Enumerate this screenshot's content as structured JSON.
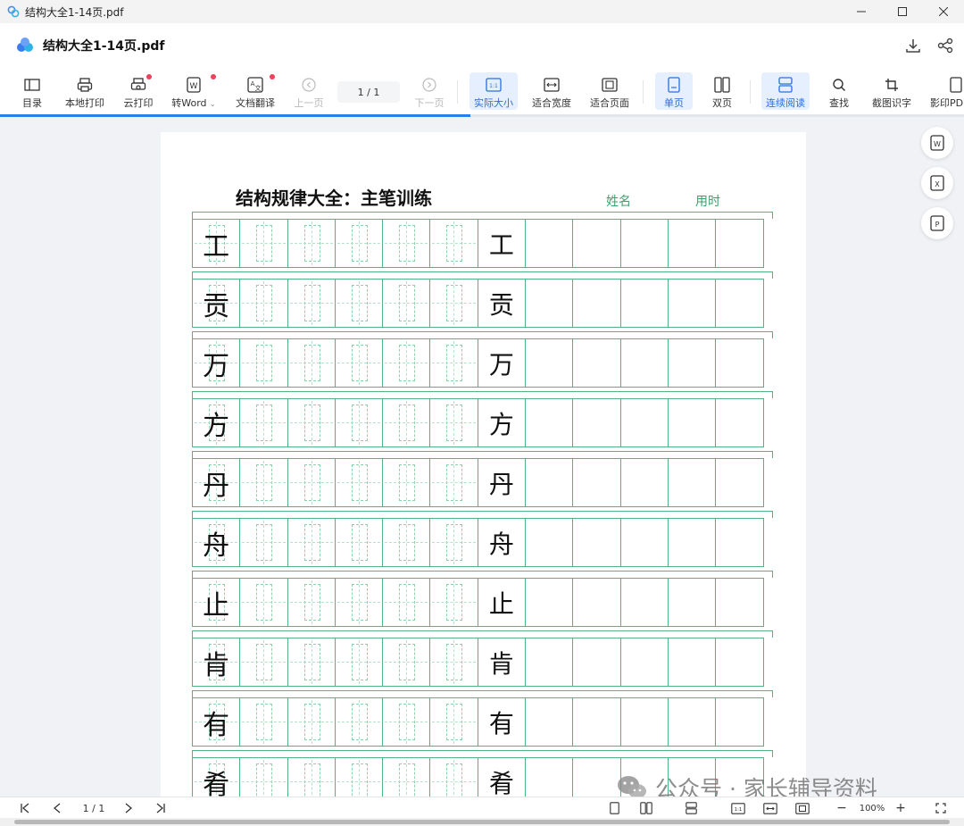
{
  "window": {
    "title": "结构大全1-14页.pdf",
    "controls": [
      "minimize-icon",
      "maximize-icon",
      "close-icon"
    ]
  },
  "header": {
    "doc_name": "结构大全1-14页.pdf",
    "actions": [
      "download-icon",
      "share-icon"
    ]
  },
  "toolbar": {
    "toc": "目录",
    "local_print": "本地打印",
    "cloud_print": "云打印",
    "to_word": "转Word",
    "translate": "文档翻译",
    "prev_page": "上一页",
    "page_indicator": "1  / 1",
    "next_page": "下一页",
    "actual_size": "实际大小",
    "fit_width": "适合宽度",
    "fit_page": "适合页面",
    "single_page": "单页",
    "double_page": "双页",
    "continuous": "连续阅读",
    "find": "查找",
    "ocr": "截图识字",
    "print_pdf": "影印PDF",
    "active_color": "#2b6de0",
    "badge_color": "#f0405a"
  },
  "document": {
    "title": "结构规律大全：主笔训练",
    "name_label": "姓名",
    "time_label": "用时",
    "grid_color": "#54b383",
    "characters": [
      "工",
      "贡",
      "万",
      "方",
      "丹",
      "舟",
      "止",
      "肯",
      "有",
      "肴"
    ]
  },
  "side_tools": [
    "word-convert-icon",
    "excel-convert-icon",
    "ppt-convert-icon"
  ],
  "watermark": {
    "text": "公众号 · 家长辅导资料"
  },
  "statusbar": {
    "page_indicator": "1 / 1",
    "zoom": "100%"
  }
}
